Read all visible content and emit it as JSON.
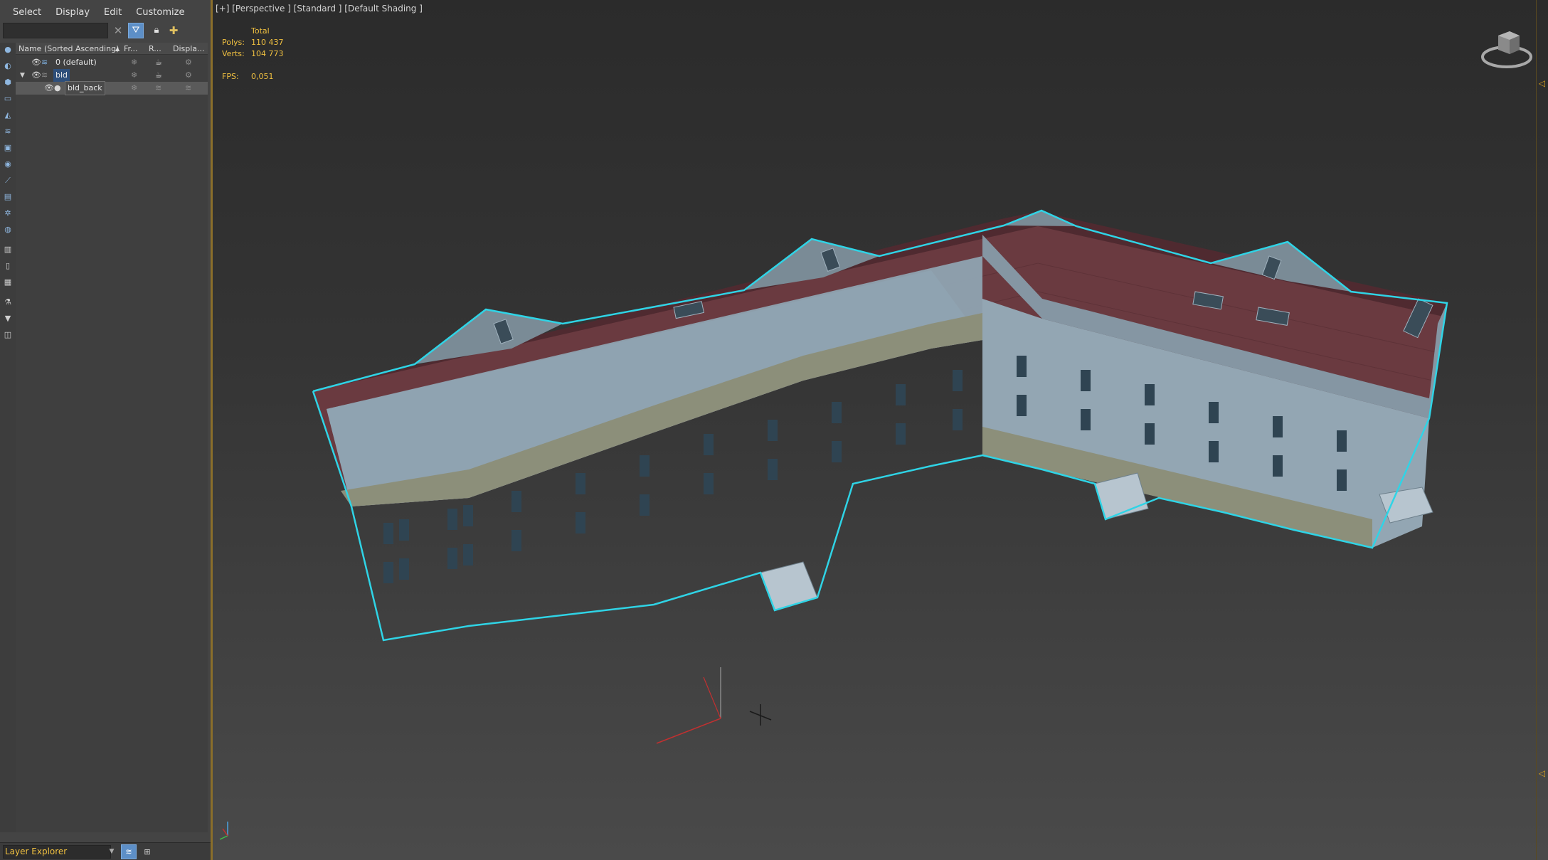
{
  "menu": [
    "Select",
    "Display",
    "Edit",
    "Customize"
  ],
  "search": {
    "placeholder": ""
  },
  "tree": {
    "header": {
      "name": "Name (Sorted Ascending)",
      "sort": "▲",
      "frozen": "Fr...",
      "render": "R...",
      "display": "Displa..."
    },
    "rows": [
      {
        "label": "0 (default)"
      },
      {
        "label": "bld"
      },
      {
        "label": "bld_back"
      }
    ]
  },
  "bottom": {
    "explorer_label": "Layer Explorer"
  },
  "viewport": {
    "label": "[+] [Perspective ] [Standard ] [Default Shading ]",
    "stats": {
      "total_label": "Total",
      "polys_label": "Polys:",
      "polys_value": "110 437",
      "verts_label": "Verts:",
      "verts_value": "104 773",
      "fps_label": "FPS:",
      "fps_value": "0,051"
    }
  },
  "colors": {
    "accent": "#5d8fc7",
    "selection_outline": "#2fd4e6",
    "stat_text": "#f0c040",
    "roof": "#6a3a40",
    "facade": "#8fa3b1"
  },
  "icons": [
    "close-icon",
    "filter-icon",
    "lock-icon",
    "new-layer-icon",
    "eye-icon",
    "layer-stack-icon",
    "snowflake-icon",
    "teapot-icon"
  ]
}
